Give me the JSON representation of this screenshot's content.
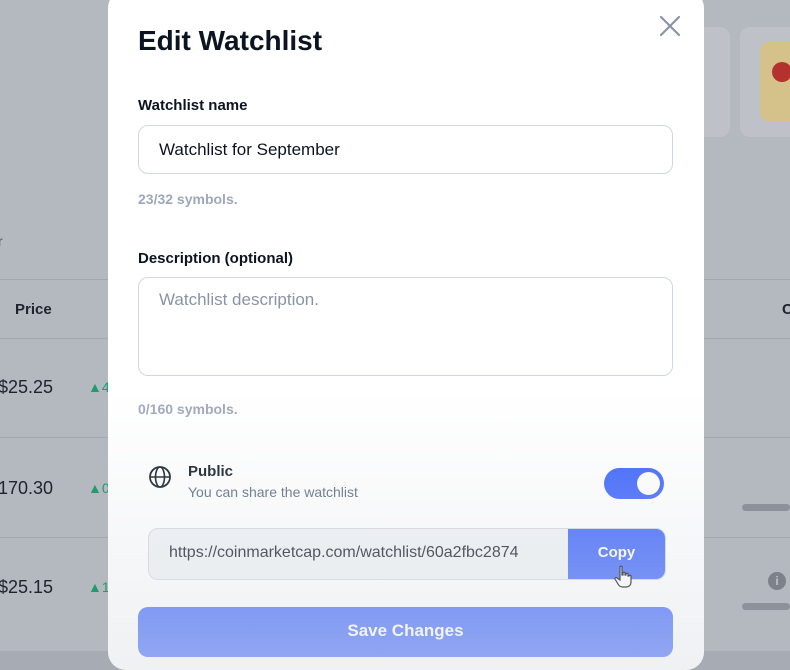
{
  "background": {
    "column_header": "Price",
    "partial_label": "r",
    "right_header": "C",
    "card_text": "!",
    "rows": [
      {
        "price": "$25.25",
        "change": "▲4"
      },
      {
        "price": "170.30",
        "change": "▲0"
      },
      {
        "price": "$25.15",
        "change": "▲1"
      }
    ],
    "info_icon_glyph": "i"
  },
  "modal": {
    "title": "Edit Watchlist",
    "close_icon": "close-icon",
    "name": {
      "label": "Watchlist name",
      "value": "Watchlist for September",
      "hint": "23/32 symbols."
    },
    "description": {
      "label": "Description (optional)",
      "placeholder": "Watchlist description.",
      "hint": "0/160 symbols."
    },
    "public": {
      "icon": "globe-icon",
      "title": "Public",
      "subtitle": "You can share the watchlist",
      "enabled": true
    },
    "share": {
      "url": "https://coinmarketcap.com/watchlist/60a2fbc2874",
      "copy_label": "Copy"
    },
    "save_label": "Save Changes"
  },
  "colors": {
    "accent": "#3861fb",
    "text": "#0d1421",
    "muted": "#a1a7bb"
  }
}
